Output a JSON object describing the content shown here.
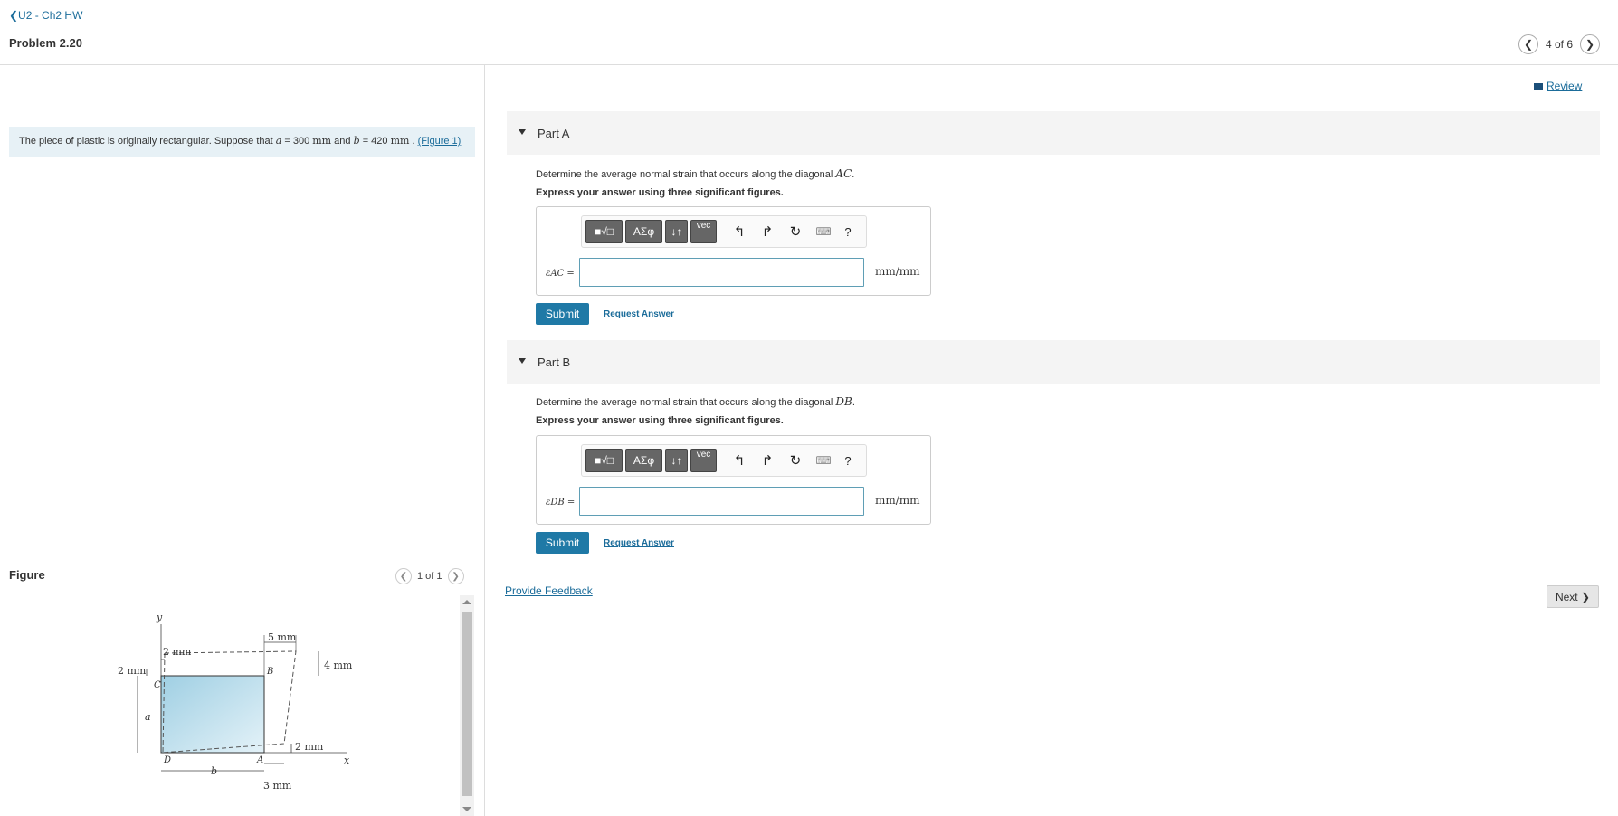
{
  "header": {
    "breadcrumb": "❮U2 - Ch2 HW",
    "problem_title": "Problem 2.20",
    "pager_text": "4 of 6"
  },
  "review_label": "Review",
  "statement": {
    "text1": "The piece of plastic is originally rectangular. Suppose that",
    "var_a": "a",
    "eq1": " = 300 ",
    "unit1": "mm",
    "and": " and ",
    "var_b": "b",
    "eq2": " = 420 ",
    "unit2": "mm",
    "dot": " . ",
    "figure_link": "(Figure 1)"
  },
  "parts": [
    {
      "title": "Part A",
      "question": "Determine the average normal strain that occurs along the diagonal ",
      "diag": "AC",
      "instruction": "Express your answer using three significant figures.",
      "label": "εAC =",
      "value": "",
      "unit": "mm/mm",
      "submit": "Submit",
      "request": "Request Answer"
    },
    {
      "title": "Part B",
      "question": "Determine the average normal strain that occurs along the diagonal ",
      "diag": "DB",
      "instruction": "Express your answer using three significant figures.",
      "label": "εDB =",
      "value": "",
      "unit": "mm/mm",
      "submit": "Submit",
      "request": "Request Answer"
    }
  ],
  "toolbar": {
    "templates": "■√□",
    "greek": "ΑΣφ",
    "arrows": "↓↑",
    "vec": "vec",
    "undo": "↰",
    "redo": "↱",
    "reset": "↻",
    "keyboard": "⌨",
    "help": "?"
  },
  "feedback": "Provide Feedback",
  "next": "Next ❯",
  "figure": {
    "label": "Figure",
    "pager": "1 of 1",
    "labels": {
      "y": "y",
      "x": "x",
      "five_mm": "5 mm",
      "two_mm_top": "2 mm",
      "four_mm": "4 mm",
      "two_mm_left": "2 mm",
      "two_mm_right": "2 mm",
      "three_mm": "3 mm",
      "a": "a",
      "b": "b",
      "C": "C",
      "B": "B",
      "D": "D",
      "A": "A"
    }
  }
}
